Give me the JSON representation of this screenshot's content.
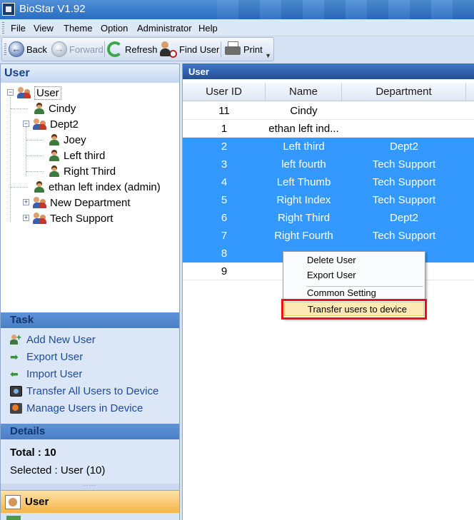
{
  "window": {
    "title": "BioStar V1.92"
  },
  "menu": [
    "File",
    "View",
    "Theme",
    "Option",
    "Administrator",
    "Help"
  ],
  "toolbar": {
    "back": "Back",
    "forward": "Forward",
    "refresh": "Refresh",
    "find_user": "Find User",
    "print": "Print"
  },
  "left": {
    "header": "User",
    "tree": {
      "root": "User",
      "cindy": "Cindy",
      "dept2": "Dept2",
      "joey": "Joey",
      "left_third": "Left third",
      "right_third": "Right Third",
      "ethan": "ethan left index (admin)",
      "new_department": "New Department",
      "tech_support": "Tech Support"
    },
    "task": {
      "header": "Task",
      "items": [
        "Add New User",
        "Export User",
        "Import User",
        "Transfer All Users to Device",
        "Manage Users in Device"
      ]
    },
    "details": {
      "header": "Details",
      "total": "Total : 10",
      "selected": "Selected : User (10)"
    },
    "nav": {
      "user": "User"
    }
  },
  "right": {
    "header": "User",
    "columns": [
      "User ID",
      "Name",
      "Department"
    ],
    "rows": [
      {
        "id": "11",
        "name": "Cindy",
        "dept": "",
        "selected": false
      },
      {
        "id": "1",
        "name": "ethan left ind...",
        "dept": "",
        "selected": false
      },
      {
        "id": "2",
        "name": "Left third",
        "dept": "Dept2",
        "selected": true
      },
      {
        "id": "3",
        "name": "left fourth",
        "dept": "Tech Support",
        "selected": true
      },
      {
        "id": "4",
        "name": "Left Thumb",
        "dept": "Tech Support",
        "selected": true
      },
      {
        "id": "5",
        "name": "Right Index",
        "dept": "Tech Support",
        "selected": true
      },
      {
        "id": "6",
        "name": "Right Third",
        "dept": "Dept2",
        "selected": true
      },
      {
        "id": "7",
        "name": "Right Fourth",
        "dept": "Tech Support",
        "selected": true
      },
      {
        "id": "8",
        "name": "",
        "dept": "",
        "selected": true
      },
      {
        "id": "9",
        "name": "",
        "dept": "",
        "selected": false
      }
    ]
  },
  "context_menu": {
    "items": [
      "Delete User",
      "Export User",
      "Common Setting",
      "Transfer users to device"
    ],
    "highlighted": "Transfer users to device"
  },
  "colors": {
    "selection": "#3399ff",
    "highlight_box": "#e11111",
    "nav_active": "#f7b44a"
  }
}
